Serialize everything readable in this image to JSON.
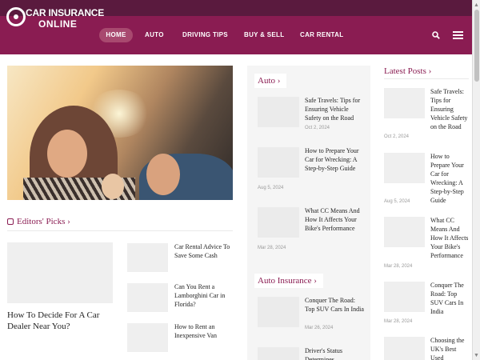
{
  "site": {
    "logo_line1": "CAR INSURANCE",
    "logo_line2": "ONLINE"
  },
  "nav": {
    "home": "HOME",
    "auto": "AUTO",
    "tips": "DRIVING TIPS",
    "buy": "BUY & SELL",
    "rental": "CAR RENTAL"
  },
  "editors": {
    "title": "Editors' Picks",
    "featured_title": "How To Decide For A Car Dealer Near You?",
    "items": [
      {
        "title": "Car Rental Advice To Save Some Cash"
      },
      {
        "title": "Can You Rent a Lamborghini Car in Florida?"
      },
      {
        "title": "How to Rent an Inexpensive Van"
      }
    ]
  },
  "auto": {
    "title": "Auto",
    "items": [
      {
        "title": "Safe Travels: Tips for Ensuring Vehicle Safety on the Road",
        "date": "Oct 2, 2024"
      },
      {
        "title": "How to Prepare Your Car for Wrecking: A Step-by-Step Guide",
        "date": "Aug 5, 2024"
      },
      {
        "title": "What CC Means And How It Affects Your Bike's Performance",
        "date": "Mar 28, 2024"
      }
    ]
  },
  "auto_insurance": {
    "title": "Auto Insurance",
    "items": [
      {
        "title": "Conquer The Road: Top SUV Cars In India",
        "date": "Mar 26, 2024"
      },
      {
        "title": "Driver's Status Determines"
      }
    ]
  },
  "latest": {
    "title": "Latest Posts",
    "items": [
      {
        "title": "Safe Travels: Tips for Ensuring Vehicle Safety on the Road",
        "date": "Oct 2, 2024"
      },
      {
        "title": "How to Prepare Your Car for Wrecking: A Step-by-Step Guide",
        "date": "Aug 5, 2024"
      },
      {
        "title": "What CC Means And How It Affects Your Bike's Performance",
        "date": "Mar 28, 2024"
      },
      {
        "title": "Conquer The Road: Top SUV Cars In India",
        "date": "Mar 28, 2024"
      },
      {
        "title": "Choosing the UK's Best Used"
      }
    ]
  },
  "icons": {
    "search": "search-icon",
    "menu": "hamburger-menu-icon",
    "chevron": "chevron-right-icon",
    "check": "check-square-icon"
  },
  "colors": {
    "brand": "#8a1c52",
    "topbar": "#5a1a3e"
  }
}
